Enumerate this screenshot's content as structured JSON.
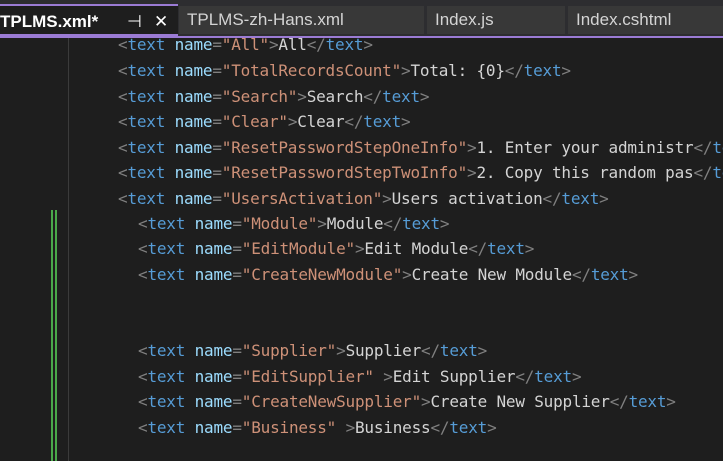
{
  "tabs": [
    {
      "label": "TPLMS.xml*",
      "active": true,
      "pin_glyph": "⊣",
      "close_glyph": "✕"
    },
    {
      "label": "TPLMS-zh-Hans.xml",
      "active": false
    },
    {
      "label": "Index.js",
      "active": false
    },
    {
      "label": "Index.cshtml",
      "active": false
    }
  ],
  "editor": {
    "tag_name": "text",
    "attr_name": "name",
    "lines": [
      {
        "key": "All",
        "value": "All",
        "indent": 0
      },
      {
        "key": "TotalRecordsCount",
        "value": "Total: {0}",
        "indent": 0
      },
      {
        "key": "Search",
        "value": "Search",
        "indent": 0
      },
      {
        "key": "Clear",
        "value": "Clear",
        "indent": 0
      },
      {
        "key": "ResetPasswordStepOneInfo",
        "value": "1. Enter your administr",
        "indent": 0
      },
      {
        "key": "ResetPasswordStepTwoInfo",
        "value": "2. Copy this random pas",
        "indent": 0
      },
      {
        "key": "UsersActivation",
        "value": "Users activation",
        "indent": 0
      },
      {
        "key": "Module",
        "value": "Module",
        "indent": 1
      },
      {
        "key": "EditModule",
        "value": "Edit Module",
        "indent": 1
      },
      {
        "key": "CreateNewModule",
        "value": "Create New Module",
        "indent": 1
      },
      {
        "key": "Supplier",
        "value": "Supplier",
        "indent": 1
      },
      {
        "key": "EditSupplier",
        "value": "Edit Supplier",
        "indent": 1,
        "space_before_close": true
      },
      {
        "key": "CreateNewSupplier",
        "value": "Create New Supplier",
        "indent": 1
      },
      {
        "key": "Business",
        "value": "Business",
        "indent": 1,
        "space_before_close": true
      }
    ]
  },
  "colors": {
    "tag": "#569cd6",
    "attribute": "#9cdcfe",
    "string": "#ce9178",
    "punctuation": "#808080",
    "content": "#d4d4d4",
    "accent": "#9b7bd4",
    "change_marker": "#4aa94a"
  }
}
